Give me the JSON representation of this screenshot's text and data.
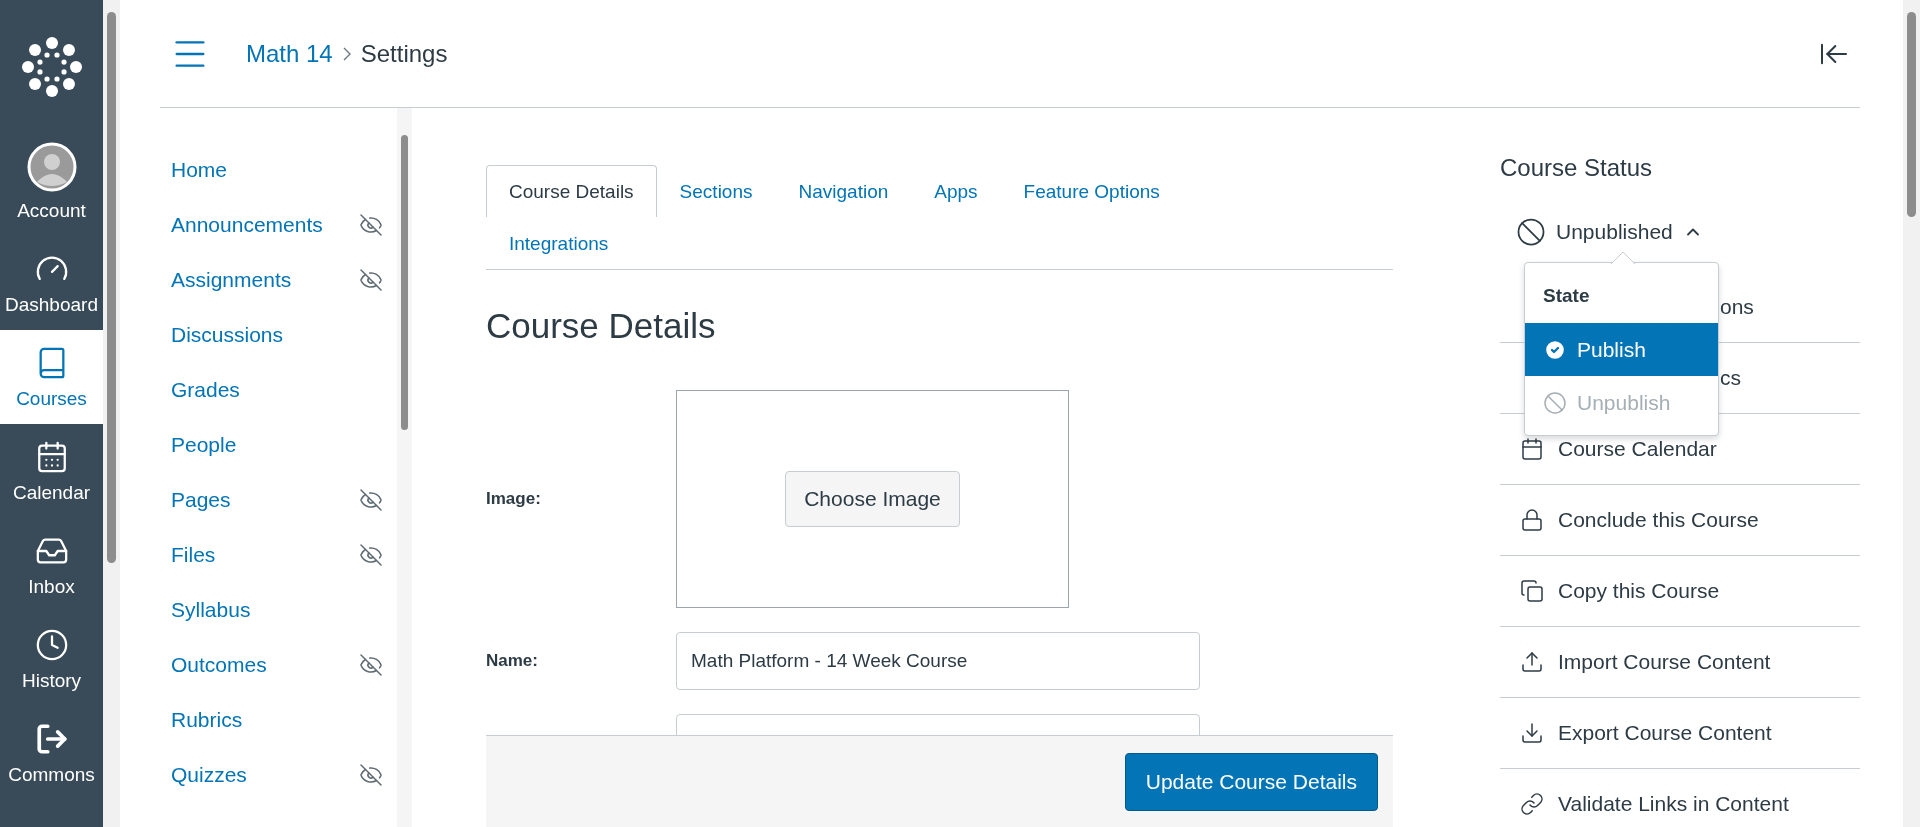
{
  "global_nav": [
    {
      "label": "Account",
      "kind": "account",
      "selected": false
    },
    {
      "label": "Dashboard",
      "kind": "dashboard",
      "selected": false
    },
    {
      "label": "Courses",
      "kind": "courses",
      "selected": true
    },
    {
      "label": "Calendar",
      "kind": "calendar",
      "selected": false
    },
    {
      "label": "Inbox",
      "kind": "inbox",
      "selected": false
    },
    {
      "label": "History",
      "kind": "history",
      "selected": false
    },
    {
      "label": "Commons",
      "kind": "commons",
      "selected": false
    }
  ],
  "breadcrumb": [
    "Math 14",
    "Settings"
  ],
  "course_nav": [
    {
      "label": "Home",
      "hidden": false
    },
    {
      "label": "Announcements",
      "hidden": true
    },
    {
      "label": "Assignments",
      "hidden": true
    },
    {
      "label": "Discussions",
      "hidden": false
    },
    {
      "label": "Grades",
      "hidden": false
    },
    {
      "label": "People",
      "hidden": false
    },
    {
      "label": "Pages",
      "hidden": true
    },
    {
      "label": "Files",
      "hidden": true
    },
    {
      "label": "Syllabus",
      "hidden": false
    },
    {
      "label": "Outcomes",
      "hidden": true
    },
    {
      "label": "Rubrics",
      "hidden": false
    },
    {
      "label": "Quizzes",
      "hidden": true
    }
  ],
  "tabs": [
    {
      "label": "Course Details",
      "selected": true
    },
    {
      "label": "Sections",
      "selected": false
    },
    {
      "label": "Navigation",
      "selected": false
    },
    {
      "label": "Apps",
      "selected": false
    },
    {
      "label": "Feature Options",
      "selected": false
    },
    {
      "label": "Integrations",
      "selected": false
    }
  ],
  "heading": "Course Details",
  "form": {
    "image": {
      "label": "Image:",
      "button": "Choose Image"
    },
    "name": {
      "label": "Name:",
      "value": "Math Platform - 14 Week Course"
    }
  },
  "submit": "Update Course Details",
  "sidebar": {
    "title": "Course Status",
    "status": {
      "label": "Unpublished",
      "expanded": true
    },
    "menu": {
      "title": "State",
      "options": [
        {
          "label": "Publish",
          "kind": "publish",
          "selected": true,
          "disabled": false
        },
        {
          "label": "Unpublish",
          "kind": "unpublish",
          "selected": false,
          "disabled": true
        }
      ]
    },
    "actions": [
      {
        "label": "ons",
        "kind": "covered"
      },
      {
        "label": "cs",
        "kind": "covered"
      },
      {
        "label": "Course Calendar",
        "kind": "calendar"
      },
      {
        "label": "Conclude this Course",
        "kind": "lock"
      },
      {
        "label": "Copy this Course",
        "kind": "copy"
      },
      {
        "label": "Import Course Content",
        "kind": "import"
      },
      {
        "label": "Export Course Content",
        "kind": "export"
      },
      {
        "label": "Validate Links in Content",
        "kind": "link"
      }
    ]
  }
}
